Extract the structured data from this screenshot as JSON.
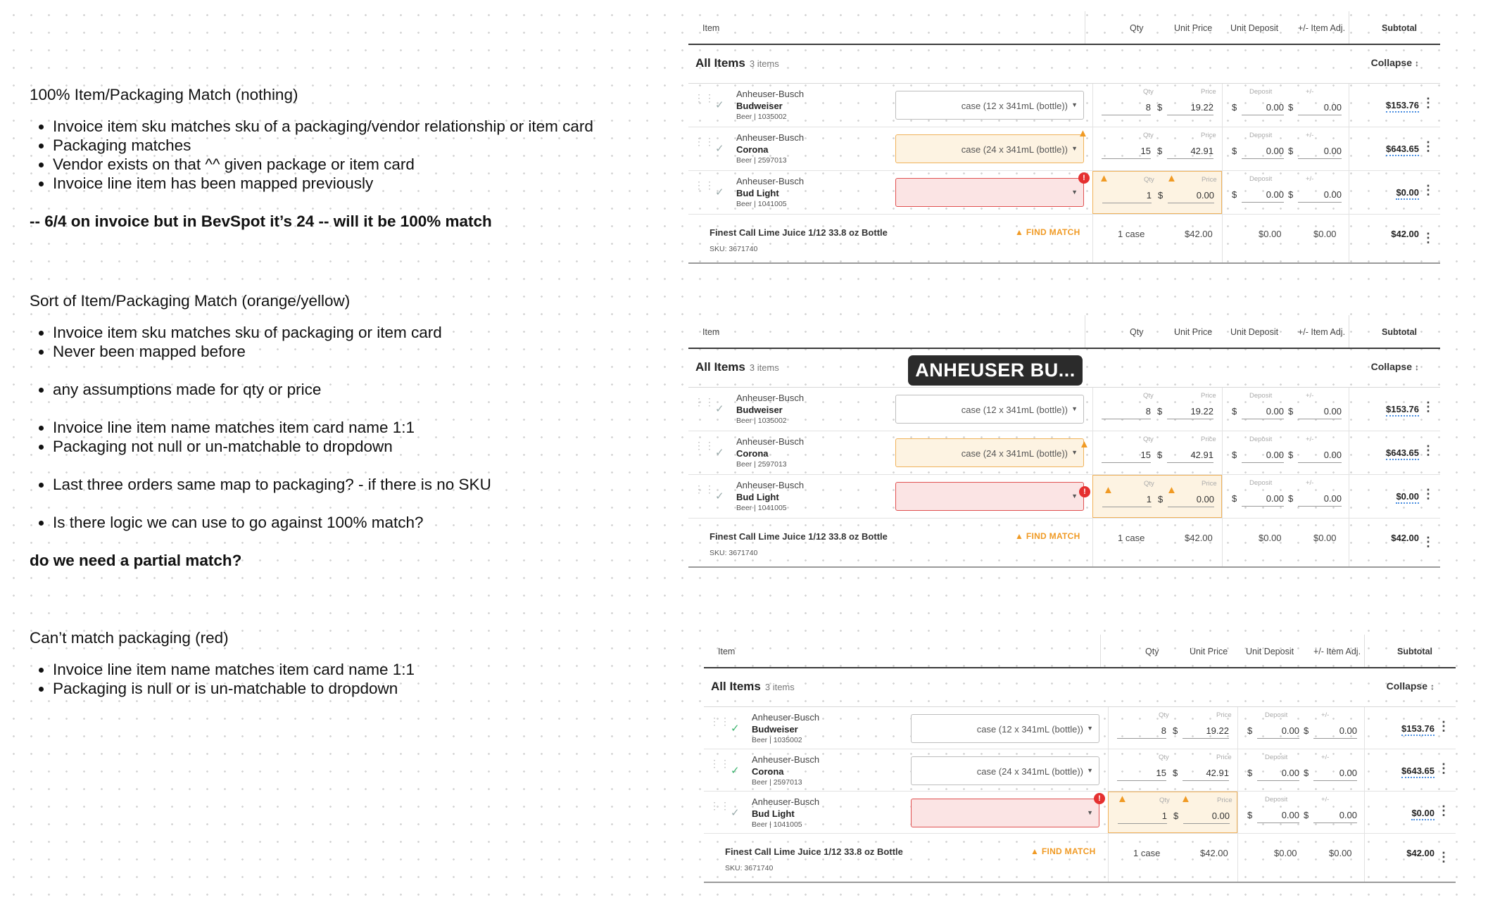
{
  "notes": [
    {
      "title": "100% Item/Packaging Match (nothing)",
      "bullets": [
        "Invoice item sku matches sku of a packaging/vendor relationship or item card",
        "Packaging matches",
        "Vendor exists on that ^^ given package or item card",
        "Invoice line item has been mapped previously"
      ],
      "bold": "-- 6/4 on invoice but in BevSpot it’s 24 -- will it be 100% match"
    },
    {
      "title": "Sort of Item/Packaging Match (orange/yellow)",
      "bullets": [
        "Invoice item sku matches sku of packaging or item card",
        "Never been mapped before",
        "any assumptions made for qty or price",
        "Invoice line item name matches item card name 1:1",
        "Packaging not null or un-matchable to dropdown",
        "Last three orders same map to packaging? - if there is no SKU",
        "Is there logic we can use to go against 100% match?"
      ],
      "bold": "do we need a partial match?"
    },
    {
      "title": "Can’t match packaging (red)",
      "bullets": [
        "Invoice line item name matches item card name 1:1",
        "Packaging is null or is un-matchable to dropdown"
      ]
    }
  ],
  "table_header": {
    "item": "Item",
    "qty": "Qty",
    "unit_price": "Unit Price",
    "unit_deposit": "Unit Deposit",
    "item_adj": "+/- Item Adj.",
    "subtotal": "Subtotal"
  },
  "all_items": {
    "label": "All Items",
    "count": "3 items",
    "collapse": "Collapse",
    "collapse_icon": "↕"
  },
  "field_labels": {
    "qty": "Qty",
    "price": "Price",
    "deposit": "Deposit",
    "adj": "+/-",
    "dollar": "$"
  },
  "rows": [
    {
      "vendor": "Anheuser-Busch",
      "name": "Budweiser",
      "cat": "Beer  |  1035002",
      "pkg": "case (12 x 341mL (bottle))",
      "qty": "8",
      "price": "19.22",
      "deposit": "0.00",
      "adj": "0.00",
      "subtotal": "$153.76"
    },
    {
      "vendor": "Anheuser-Busch",
      "name": "Corona",
      "cat": "Beer  |  2597013",
      "pkg": "case (24 x 341mL (bottle))",
      "qty": "15",
      "price": "42.91",
      "deposit": "0.00",
      "adj": "0.00",
      "subtotal": "$643.65"
    },
    {
      "vendor": "Anheuser-Busch",
      "name": "Bud Light",
      "cat": "Beer  |  1041005",
      "pkg": "",
      "qty": "1",
      "price": "0.00",
      "deposit": "0.00",
      "adj": "0.00",
      "subtotal": "$0.00"
    }
  ],
  "unmatched": {
    "name": "Finest Call Lime Juice 1/12 33.8 oz Bottle",
    "sku": "SKU: 3671740",
    "find_match": "FIND MATCH",
    "qty": "1 case",
    "price": "$42.00",
    "deposit": "$0.00",
    "adj": "$0.00",
    "subtotal": "$42.00"
  },
  "tooltip": "ANHEUSER BU...",
  "colors": {
    "warning": "#f09a24",
    "error": "#e53030",
    "success": "#3cb46e",
    "link_dots": "#4a8ee0"
  }
}
